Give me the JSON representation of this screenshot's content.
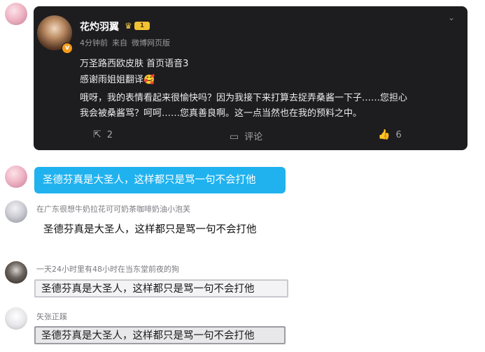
{
  "post": {
    "username": "花灼羽翼",
    "level": "1",
    "time": "4分钟前",
    "source_prefix": "来自",
    "source": "微博网页版",
    "lines": [
      "万圣路西欧皮肤 首页语音3",
      "感谢雨姐姐翻译🥰",
      "哦呀，我的表情看起来很愉快吗？因为我接下来打算去捉弄桑酱一下子……您担心",
      "我会被桑酱骂？呵呵……您真善良啊。这一点当然也在我的预料之中。"
    ],
    "repost_count": "2",
    "comment_label": "评论",
    "like_count": "6"
  },
  "replies": [
    {
      "username": "",
      "text": "圣德芬真是大圣人，这样都只是骂一句不会打他"
    },
    {
      "username": "在广东很想牛奶拉花可可奶茶咖啡奶油小泡芙",
      "text": "圣德芬真是大圣人，这样都只是骂一句不会打他"
    },
    {
      "username": "一天24小时里有48小时在当东堂前夜的狗",
      "text": "圣德芬真是大圣人，这样都只是骂一句不会打他"
    },
    {
      "username": "矢张正蹊",
      "text": "圣德芬真是大圣人，这样都只是骂一句不会打他"
    }
  ],
  "icons": {
    "repost": "share-icon",
    "comment": "comment-icon",
    "like": "thumbs-up-icon",
    "more": "chevron-down-icon",
    "verified": "verified-badge-icon",
    "crown": "crown-icon"
  },
  "colors": {
    "card_bg": "#1d1d1f",
    "bubble_bg": "#1fb2ef",
    "verified": "#f59a1a"
  }
}
